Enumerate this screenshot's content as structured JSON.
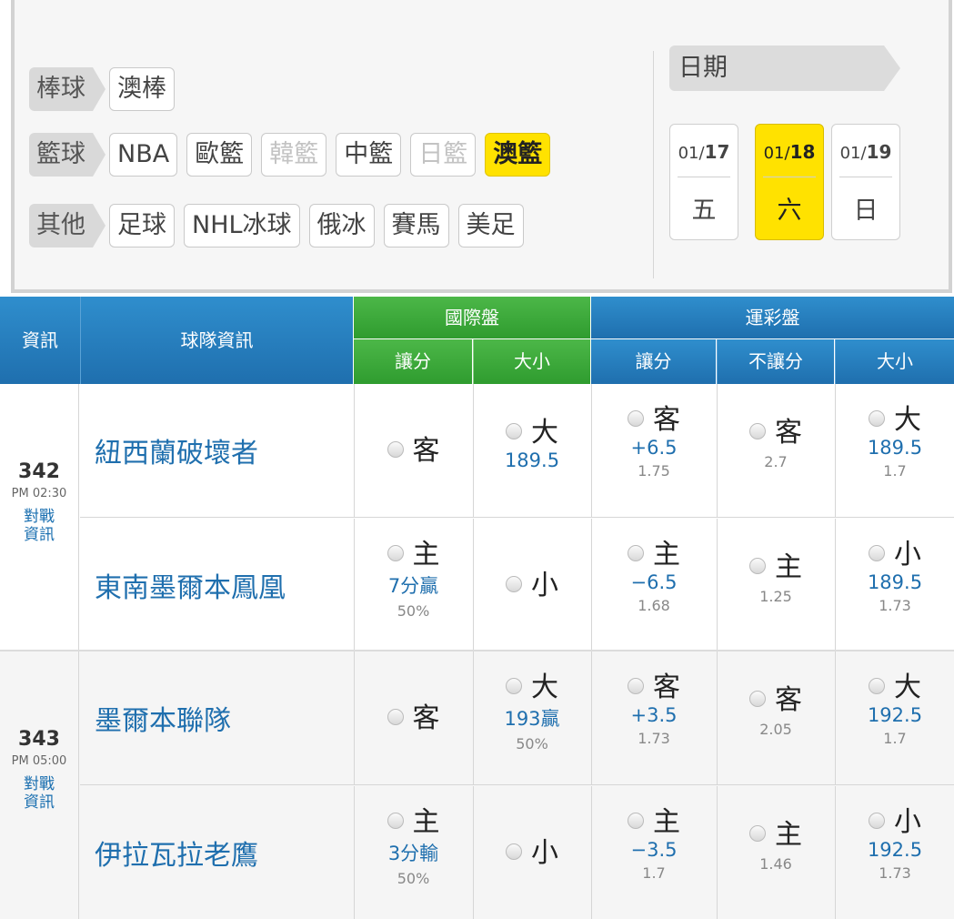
{
  "filters": {
    "rows": [
      {
        "category": "棒球",
        "items": [
          {
            "label": "澳棒",
            "state": "normal"
          }
        ]
      },
      {
        "category": "籃球",
        "items": [
          {
            "label": "NBA",
            "state": "normal"
          },
          {
            "label": "歐籃",
            "state": "normal"
          },
          {
            "label": "韓籃",
            "state": "disabled"
          },
          {
            "label": "中籃",
            "state": "normal"
          },
          {
            "label": "日籃",
            "state": "disabled"
          },
          {
            "label": "澳籃",
            "state": "selected"
          }
        ]
      },
      {
        "category": "其他",
        "items": [
          {
            "label": "足球",
            "state": "normal"
          },
          {
            "label": "NHL冰球",
            "state": "normal"
          },
          {
            "label": "俄冰",
            "state": "normal"
          },
          {
            "label": "賽馬",
            "state": "normal"
          },
          {
            "label": "美足",
            "state": "normal"
          }
        ]
      }
    ],
    "date_label": "日期",
    "dates": [
      {
        "month": "01/",
        "day": "17",
        "weekday": "五",
        "selected": false
      },
      {
        "month": "01/",
        "day": "18",
        "weekday": "六",
        "selected": true
      },
      {
        "month": "01/",
        "day": "19",
        "weekday": "日",
        "selected": false
      }
    ]
  },
  "table_header": {
    "info": "資訊",
    "team_info": "球隊資訊",
    "intl_group": "國際盤",
    "sport_group": "運彩盤",
    "intl_cols": [
      "讓分",
      "大小"
    ],
    "sport_cols": [
      "讓分",
      "不讓分",
      "大小"
    ]
  },
  "games": [
    {
      "no": "342",
      "time": "PM 02:30",
      "vs_label_1": "對戰",
      "vs_label_2": "資訊",
      "rows": [
        {
          "team": "紐西蘭破壞者",
          "cells": [
            {
              "main": "客",
              "val": "",
              "pct": ""
            },
            {
              "main": "大",
              "val": "189.5",
              "pct": ""
            },
            {
              "main": "客",
              "val": "+6.5",
              "pct": "1.75"
            },
            {
              "main": "客",
              "val": "",
              "pct": "2.7"
            },
            {
              "main": "大",
              "val": "189.5",
              "pct": "1.7"
            }
          ]
        },
        {
          "team": "東南墨爾本鳳凰",
          "cells": [
            {
              "main": "主",
              "val": "7分贏",
              "pct": "50%"
            },
            {
              "main": "小",
              "val": "",
              "pct": ""
            },
            {
              "main": "主",
              "val": "−6.5",
              "pct": "1.68"
            },
            {
              "main": "主",
              "val": "",
              "pct": "1.25"
            },
            {
              "main": "小",
              "val": "189.5",
              "pct": "1.73"
            }
          ]
        }
      ]
    },
    {
      "no": "343",
      "time": "PM 05:00",
      "vs_label_1": "對戰",
      "vs_label_2": "資訊",
      "rows": [
        {
          "team": "墨爾本聯隊",
          "cells": [
            {
              "main": "客",
              "val": "",
              "pct": ""
            },
            {
              "main": "大",
              "val": "193贏",
              "pct": "50%"
            },
            {
              "main": "客",
              "val": "+3.5",
              "pct": "1.73"
            },
            {
              "main": "客",
              "val": "",
              "pct": "2.05"
            },
            {
              "main": "大",
              "val": "192.5",
              "pct": "1.7"
            }
          ]
        },
        {
          "team": "伊拉瓦拉老鷹",
          "cells": [
            {
              "main": "主",
              "val": "3分輸",
              "pct": "50%"
            },
            {
              "main": "小",
              "val": "",
              "pct": ""
            },
            {
              "main": "主",
              "val": "−3.5",
              "pct": "1.7"
            },
            {
              "main": "主",
              "val": "",
              "pct": "1.46"
            },
            {
              "main": "小",
              "val": "192.5",
              "pct": "1.73"
            }
          ]
        }
      ]
    }
  ]
}
